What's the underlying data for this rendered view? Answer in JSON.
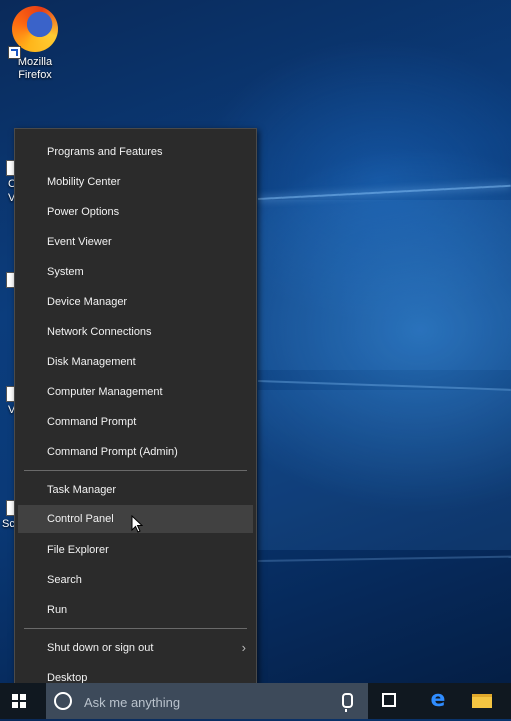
{
  "desktop": {
    "firefox_label_line1": "Mozilla",
    "firefox_label_line2": "Firefox",
    "partial_labels": [
      "C",
      "V",
      "V",
      "Sc"
    ]
  },
  "context_menu": {
    "groups": [
      [
        "Programs and Features",
        "Mobility Center",
        "Power Options",
        "Event Viewer",
        "System",
        "Device Manager",
        "Network Connections",
        "Disk Management",
        "Computer Management",
        "Command Prompt",
        "Command Prompt (Admin)"
      ],
      [
        "Task Manager",
        "Control Panel",
        "File Explorer",
        "Search",
        "Run"
      ],
      [
        "Shut down or sign out",
        "Desktop"
      ]
    ],
    "highlighted": "Control Panel",
    "submenu_arrow": "›"
  },
  "taskbar": {
    "search_placeholder": "Ask me anything",
    "icons": [
      "windows-start-icon",
      "cortana-icon",
      "microphone-icon",
      "task-view-icon",
      "edge-icon",
      "file-explorer-icon"
    ],
    "edge_glyph": "e"
  }
}
